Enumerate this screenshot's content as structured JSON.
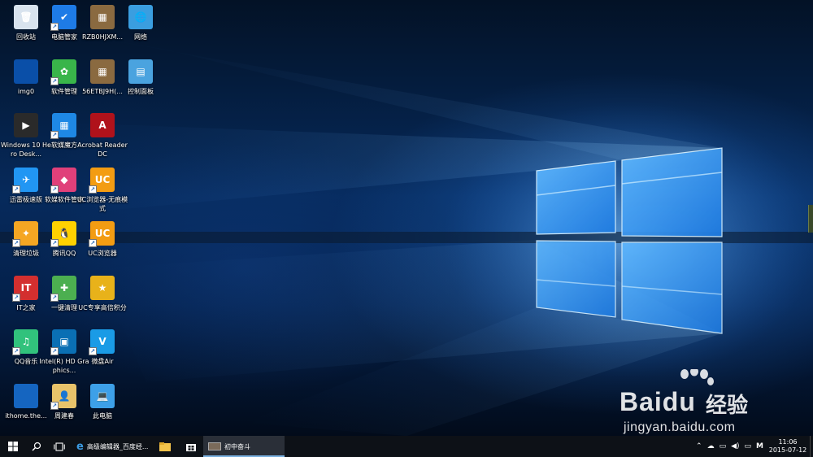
{
  "desktop_icons": [
    {
      "label": "回收站",
      "icon": "recycle-bin-icon",
      "color": "#d8e3ee",
      "glyph": "🗑"
    },
    {
      "label": "电脑管家",
      "icon": "pc-manager-icon",
      "color": "#1e7be6",
      "glyph": "✔"
    },
    {
      "label": "RZB0HJXM...",
      "icon": "movie-file-icon",
      "color": "#8a6a40",
      "glyph": "▦"
    },
    {
      "label": "网络",
      "icon": "network-icon",
      "color": "#3a9ee0",
      "glyph": "🌐"
    },
    {
      "label": "img0",
      "icon": "image-file-icon",
      "color": "#0a4fa8",
      "glyph": ""
    },
    {
      "label": "软件管理",
      "icon": "software-manager-icon",
      "color": "#39b54a",
      "glyph": "✿"
    },
    {
      "label": "56ETBJ9H(...",
      "icon": "movie-file-icon",
      "color": "#8a6a40",
      "glyph": "▦"
    },
    {
      "label": "控制面板",
      "icon": "control-panel-icon",
      "color": "#4aa3df",
      "glyph": "▤"
    },
    {
      "label": "Windows 10 Hero Desk...",
      "icon": "video-file-icon",
      "color": "#2a2a2a",
      "glyph": "▶"
    },
    {
      "label": "软媒魔方",
      "icon": "ruanmei-cube-icon",
      "color": "#1e88e5",
      "glyph": "▦"
    },
    {
      "label": "Acrobat Reader DC",
      "icon": "acrobat-icon",
      "color": "#b0121b",
      "glyph": "A"
    },
    {
      "label": "迅雷极速版",
      "icon": "xunlei-icon",
      "color": "#2196f3",
      "glyph": "✈"
    },
    {
      "label": "软媒软件管家",
      "icon": "ruanmei-software-icon",
      "color": "#e0407a",
      "glyph": "◆"
    },
    {
      "label": "UC浏览器-无痕模式",
      "icon": "uc-browser-icon",
      "color": "#f39c12",
      "glyph": "UC"
    },
    {
      "label": "清理垃圾",
      "icon": "clean-junk-icon",
      "color": "#f5a623",
      "glyph": "✦"
    },
    {
      "label": "腾讯QQ",
      "icon": "qq-icon",
      "color": "#ffd100",
      "glyph": "🐧"
    },
    {
      "label": "UC浏览器",
      "icon": "uc-browser-icon",
      "color": "#f39c12",
      "glyph": "UC"
    },
    {
      "label": "IT之家",
      "icon": "ithome-icon",
      "color": "#d32f2f",
      "glyph": "IT"
    },
    {
      "label": "一键清理",
      "icon": "one-click-clean-icon",
      "color": "#4caf50",
      "glyph": "✚"
    },
    {
      "label": "UC专享高倍积分",
      "icon": "uc-points-icon",
      "color": "#e8b21a",
      "glyph": "★"
    },
    {
      "label": "QQ音乐",
      "icon": "qq-music-icon",
      "color": "#31c27c",
      "glyph": "♫"
    },
    {
      "label": "Intel(R) HD Graphics...",
      "icon": "intel-graphics-icon",
      "color": "#0a6fb4",
      "glyph": "▣"
    },
    {
      "label": "微盘Air",
      "icon": "weipan-icon",
      "color": "#1a9be6",
      "glyph": "V"
    },
    {
      "label": "ithome.the...",
      "icon": "theme-file-icon",
      "color": "#1565c0",
      "glyph": ""
    },
    {
      "label": "周建春",
      "icon": "user-folder-icon",
      "color": "#e8c36a",
      "glyph": "👤"
    },
    {
      "label": "此电脑",
      "icon": "this-pc-icon",
      "color": "#3da0e8",
      "glyph": "💻"
    }
  ],
  "watermark": {
    "brand": "Bai",
    "brand_suffix": "du",
    "brand_cn": "经验",
    "url": "jingyan.baidu.com"
  },
  "taskbar": {
    "start_icon": "windows-start-icon",
    "search_icon": "search-icon",
    "task_view_icon": "task-view-icon",
    "apps": [
      {
        "label": "高级编辑器_百度经...",
        "icon": "edge-icon",
        "active": false
      },
      {
        "label": "",
        "icon": "file-explorer-icon",
        "active": false
      },
      {
        "label": "",
        "icon": "store-icon",
        "active": false
      },
      {
        "label": "初中奋斗",
        "icon": "video-thumb-icon",
        "active": true
      }
    ],
    "tray": {
      "input_indicator": "M",
      "time": "11:06",
      "date": "2015-07-12"
    }
  },
  "colors": {
    "taskbar_bg": "#0d1117",
    "accent": "#7ab0e0",
    "logo_glow": "#bfe6ff"
  }
}
